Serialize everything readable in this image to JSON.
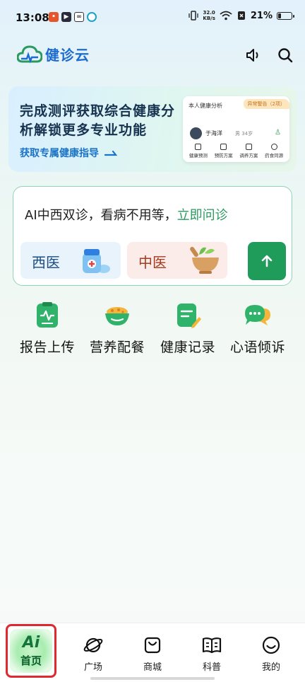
{
  "status_bar": {
    "time": "13:08",
    "speed_value": "32.0",
    "speed_unit": "KB/s",
    "battery": "21%",
    "battery_fraction": 0.21
  },
  "header": {
    "app_name": "健诊云",
    "brand_color": "#1c6bd0"
  },
  "banner": {
    "title": "完成测评获取综合健康分析解锁更多专业功能",
    "link": "获取专属健康指导",
    "card": {
      "title": "本人健康分析",
      "warning": "异常警告（2项）",
      "user_name": "于海洋",
      "user_meta": "男  34岁",
      "items": [
        "健康预测",
        "预防方案",
        "调养方案",
        "药食同源"
      ]
    }
  },
  "ask": {
    "text": "AI中西双诊，看病不用等，",
    "highlight": "立即问诊",
    "west_label": "西医",
    "east_label": "中医",
    "accent": "#1f9c5a"
  },
  "quick_actions": [
    {
      "label": "报告上传",
      "icon": "report-upload-icon"
    },
    {
      "label": "营养配餐",
      "icon": "nutrition-bowl-icon"
    },
    {
      "label": "健康记录",
      "icon": "health-record-icon"
    },
    {
      "label": "心语倾诉",
      "icon": "chat-bubbles-icon"
    }
  ],
  "bottom_nav": {
    "home": {
      "badge": "Ai",
      "label": "首页"
    },
    "items": [
      {
        "label": "广场",
        "icon": "planet-icon"
      },
      {
        "label": "商城",
        "icon": "shopping-bag-icon"
      },
      {
        "label": "科普",
        "icon": "book-icon"
      },
      {
        "label": "我的",
        "icon": "smiley-icon"
      }
    ]
  }
}
